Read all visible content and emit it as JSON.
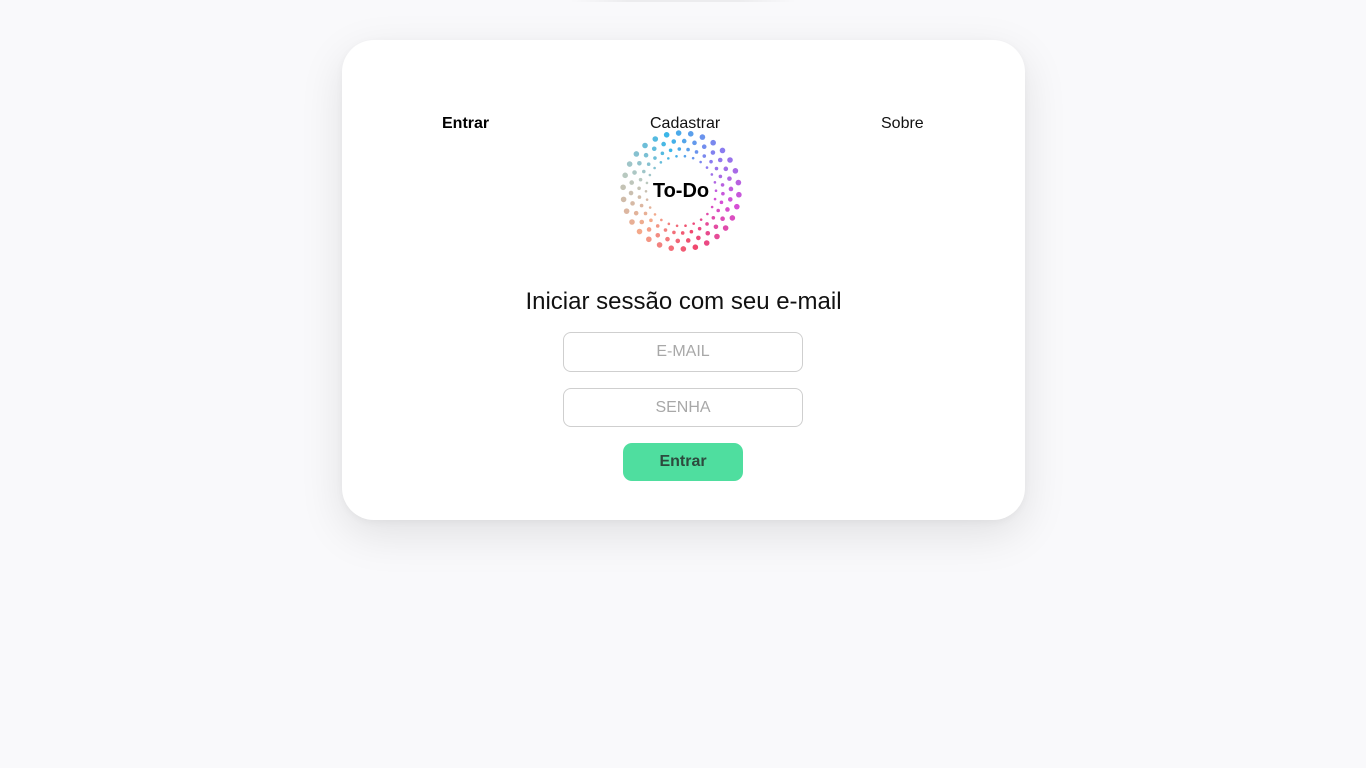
{
  "nav": {
    "items": [
      {
        "label": "Entrar",
        "active": true
      },
      {
        "label": "Cadastrar",
        "active": false
      },
      {
        "label": "Sobre",
        "active": false
      }
    ]
  },
  "logo": {
    "text": "To-Do",
    "gradient_colors": [
      "#3bb6e8",
      "#8a7cf0",
      "#d64fd6",
      "#f0486e",
      "#f4a98a",
      "#b8c9c0"
    ]
  },
  "login": {
    "heading": "Iniciar sessão com seu e-mail",
    "email_placeholder": "E-MAIL",
    "password_placeholder": "SENHA",
    "submit_label": "Entrar",
    "accent_color": "#4fde9f"
  }
}
